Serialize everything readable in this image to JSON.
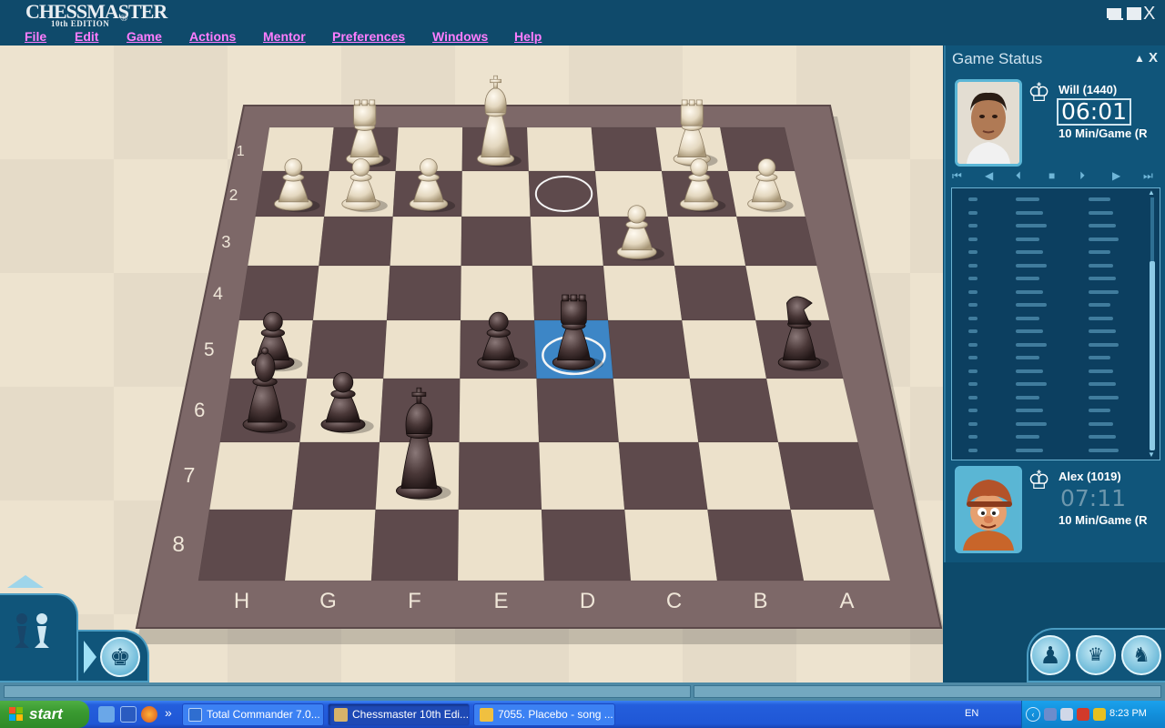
{
  "app": {
    "logo_text": "CHESSMASTER",
    "logo_edition": "10th EDITION",
    "logo_mark": "®",
    "close_label": "X"
  },
  "menu": [
    "File",
    "Edit",
    "Game",
    "Actions",
    "Mentor",
    "Preferences",
    "Windows",
    "Help"
  ],
  "board": {
    "rank_labels": [
      "1",
      "2",
      "3",
      "4",
      "5",
      "6",
      "7",
      "8"
    ],
    "file_labels": [
      "H",
      "G",
      "F",
      "E",
      "D",
      "C",
      "B",
      "A"
    ],
    "colors": {
      "light_square": "#ece1cb",
      "dark_square": "#5e4a4c",
      "frame": "#7d6868",
      "highlight": "#3d86c6"
    },
    "pieces": [
      {
        "color": "white",
        "type": "rook",
        "file": "G",
        "rank": 1
      },
      {
        "color": "white",
        "type": "king",
        "file": "E",
        "rank": 1
      },
      {
        "color": "white",
        "type": "rook",
        "file": "B",
        "rank": 1
      },
      {
        "color": "white",
        "type": "pawn",
        "file": "H",
        "rank": 2
      },
      {
        "color": "white",
        "type": "pawn",
        "file": "G",
        "rank": 2
      },
      {
        "color": "white",
        "type": "pawn",
        "file": "F",
        "rank": 2
      },
      {
        "color": "white",
        "type": "pawn",
        "file": "B",
        "rank": 2
      },
      {
        "color": "white",
        "type": "pawn",
        "file": "A",
        "rank": 2
      },
      {
        "color": "white",
        "type": "pawn",
        "file": "C",
        "rank": 3
      },
      {
        "color": "black",
        "type": "knight",
        "file": "A",
        "rank": 5
      },
      {
        "color": "black",
        "type": "pawn",
        "file": "H",
        "rank": 5
      },
      {
        "color": "black",
        "type": "pawn",
        "file": "E",
        "rank": 5
      },
      {
        "color": "black",
        "type": "rook",
        "file": "D",
        "rank": 5
      },
      {
        "color": "black",
        "type": "bishop",
        "file": "H",
        "rank": 6
      },
      {
        "color": "black",
        "type": "pawn",
        "file": "G",
        "rank": 6
      },
      {
        "color": "black",
        "type": "king",
        "file": "F",
        "rank": 7
      }
    ],
    "move_from": {
      "file": "D",
      "rank": 2
    },
    "move_to": {
      "file": "D",
      "rank": 5
    }
  },
  "status_panel": {
    "title": "Game Status",
    "collapse_label": "▲",
    "close_label": "X",
    "top_player": {
      "name": "Will (1440)",
      "clock": "06:01",
      "control": "10 Min/Game (R",
      "active": true
    },
    "bottom_player": {
      "name": "Alex (1019)",
      "clock": "07:11",
      "control": "10 Min/Game (R",
      "active": false
    },
    "nav_buttons": [
      "⏮",
      "◀",
      "⏴",
      "■",
      "⏵",
      "▶",
      "⏭"
    ],
    "move_rows": 20
  },
  "dock": {
    "expand_label": "",
    "right_buttons": [
      "pawn",
      "board",
      "pieces"
    ]
  },
  "taskbar": {
    "start_label": "start",
    "tasks": [
      {
        "label": "Total Commander 7.0...",
        "active": false
      },
      {
        "label": "Chessmaster 10th Edi...",
        "active": true
      },
      {
        "label": "7055. Placebo - song ...",
        "active": false
      }
    ],
    "more_label": "»",
    "language": "EN",
    "time": "8:23 PM"
  }
}
